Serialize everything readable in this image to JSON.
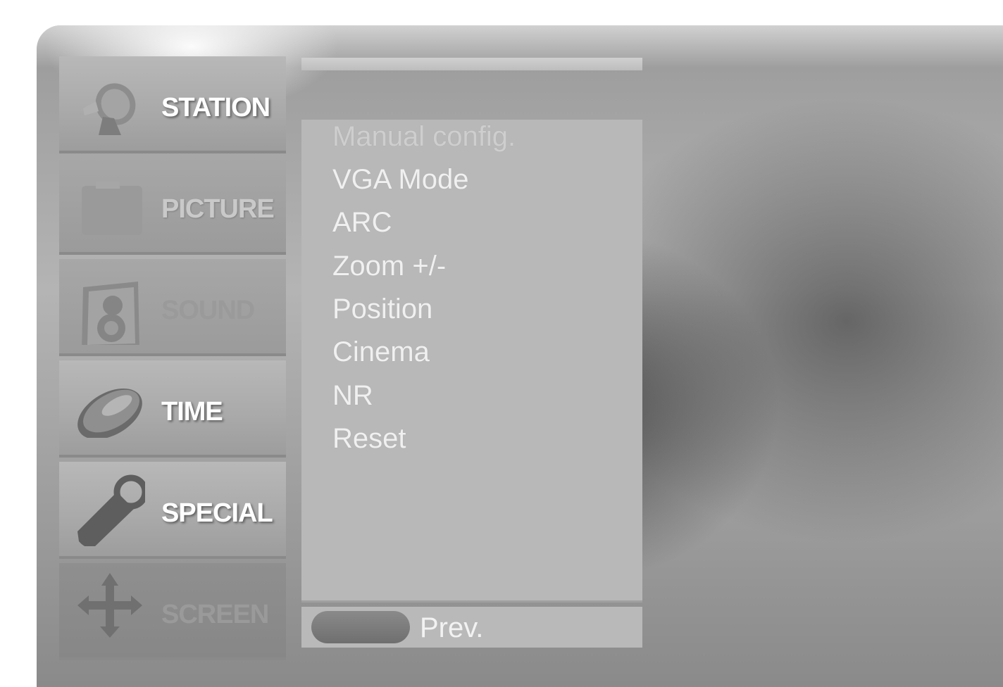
{
  "nav": {
    "items": [
      {
        "label": "STATION",
        "icon": "satellite-dish-icon"
      },
      {
        "label": "PICTURE",
        "icon": "picture-frame-icon"
      },
      {
        "label": "SOUND",
        "icon": "speaker-icon"
      },
      {
        "label": "TIME",
        "icon": "clock-disc-icon"
      },
      {
        "label": "SPECIAL",
        "icon": "tag-icon"
      },
      {
        "label": "SCREEN",
        "icon": "move-arrows-icon"
      }
    ],
    "selected": "SCREEN"
  },
  "submenu": {
    "items": [
      {
        "label": "Manual config."
      },
      {
        "label": "VGA Mode"
      },
      {
        "label": "ARC"
      },
      {
        "label": "Zoom +/-"
      },
      {
        "label": "Position"
      },
      {
        "label": "Cinema"
      },
      {
        "label": "NR"
      },
      {
        "label": "Reset"
      }
    ]
  },
  "footer": {
    "prev_label": "Prev."
  },
  "colors": {
    "panel": "#b8b8b8",
    "text": "#f0f0f0",
    "background": "#9a9a9a"
  }
}
